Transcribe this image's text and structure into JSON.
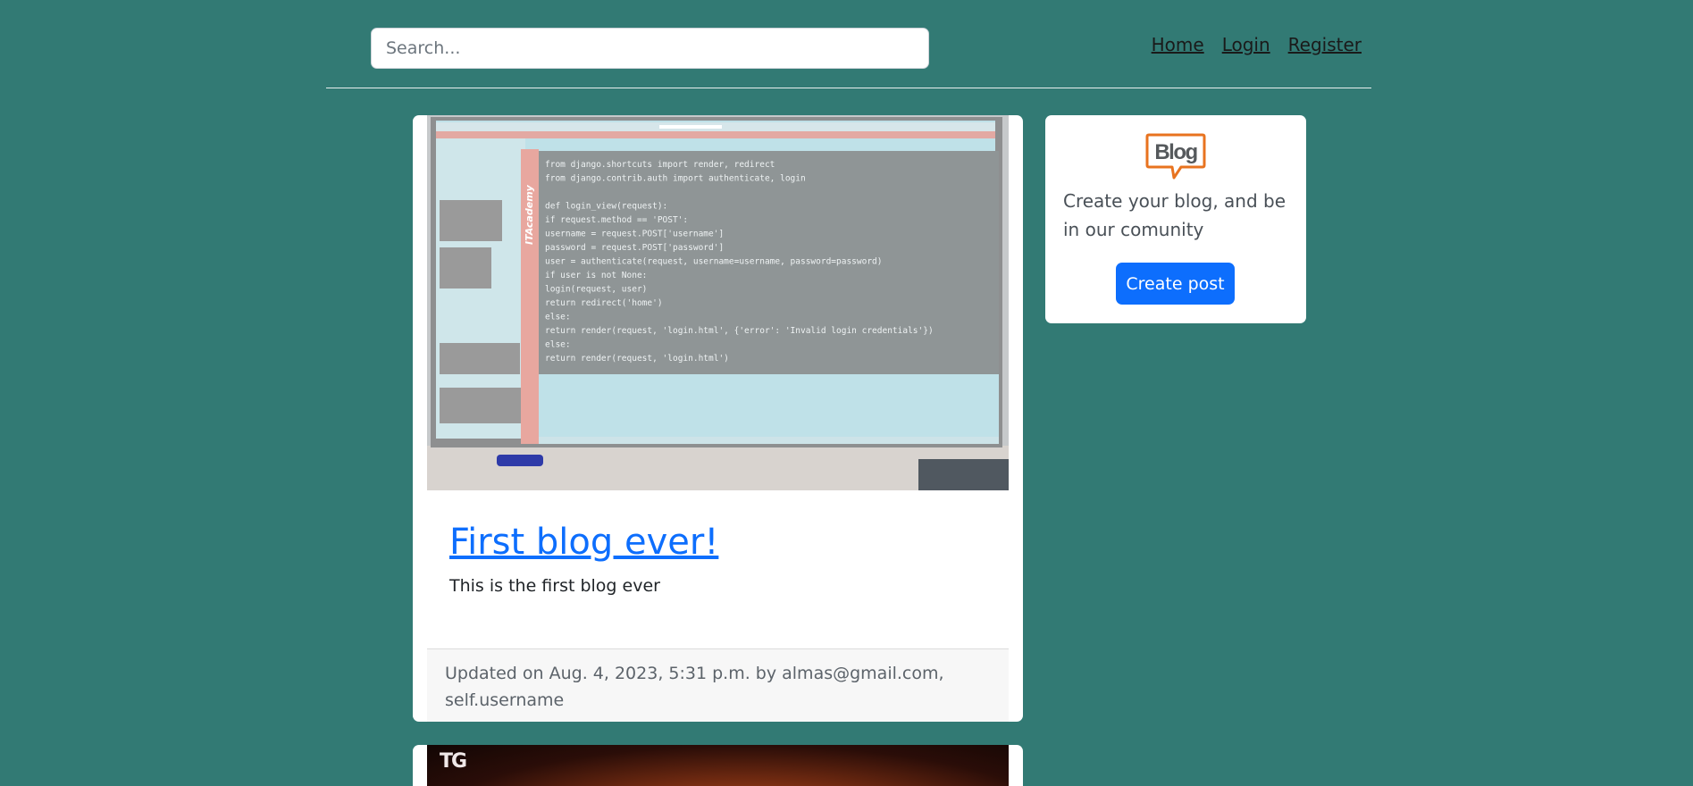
{
  "search": {
    "placeholder": "Search..."
  },
  "nav": {
    "home": "Home",
    "login": "Login",
    "register": "Register"
  },
  "posts": [
    {
      "title": "First blog ever!",
      "excerpt": "This is the first blog ever",
      "footer": "Updated on Aug. 4, 2023, 5:31 p.m. by almas@gmail.com, self.username",
      "image_overlay": {
        "sidebar_brand": "ITAcademy",
        "code_lines": [
          "from django.shortcuts import render, redirect",
          "from django.contrib.auth import authenticate, login",
          "",
          "def login_view(request):",
          "    if request.method == 'POST':",
          "        username = request.POST['username']",
          "        password = request.POST['password']",
          "        user = authenticate(request, username=username, password=password)",
          "        if user is not None:",
          "            login(request, user)",
          "            return redirect('home')",
          "        else:",
          "            return render(request, 'login.html', {'error': 'Invalid login credentials'})",
          "    else:",
          "        return render(request, 'login.html')"
        ]
      }
    },
    {
      "image_logo": "TG"
    }
  ],
  "sidebar": {
    "logo_text": "Blog",
    "text": "Create your blog, and be in our comunity",
    "create_button": "Create post"
  },
  "colors": {
    "background": "#327a74",
    "link_blue": "#0d6efd",
    "logo_orange": "#e8731f"
  }
}
